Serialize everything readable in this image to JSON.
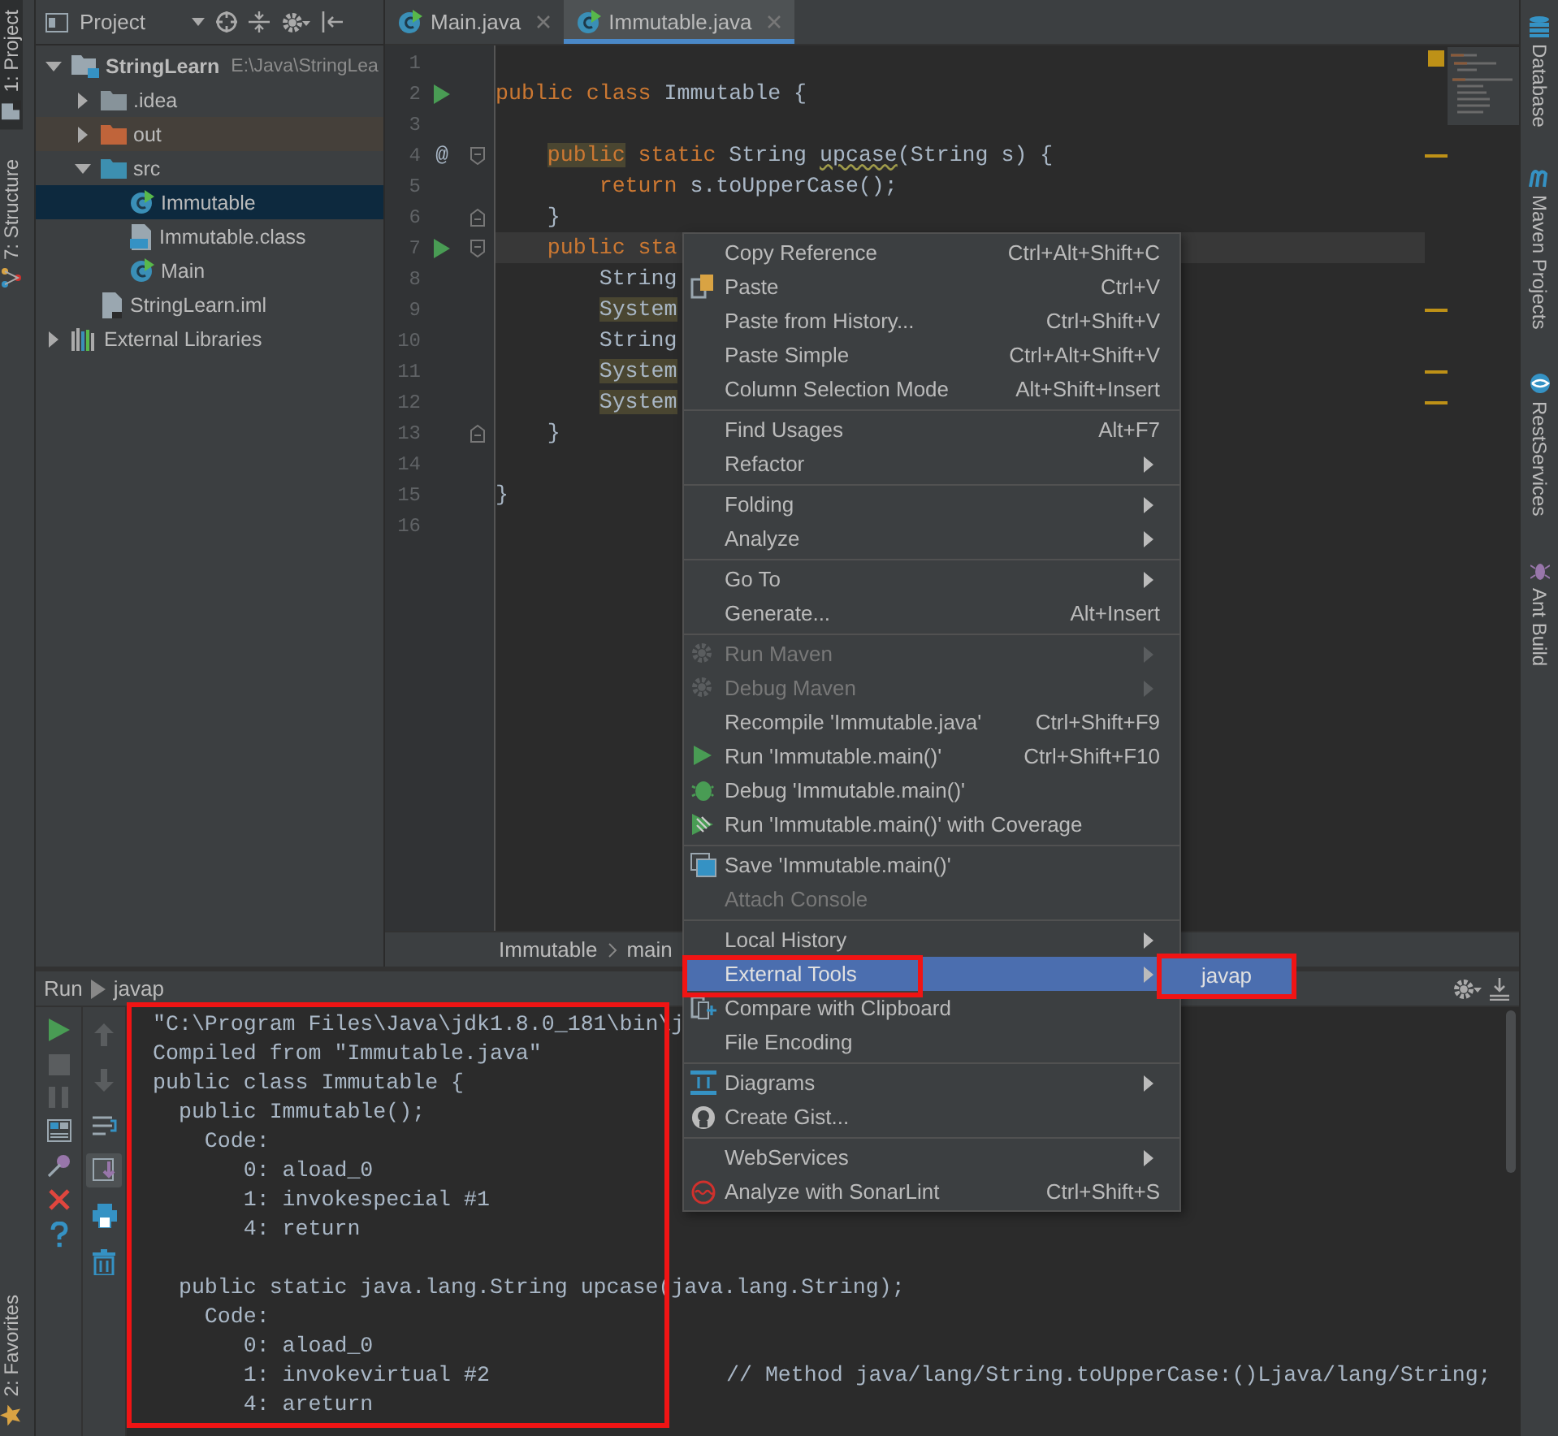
{
  "left_stripe": {
    "top": [
      {
        "label": "1: Project",
        "kind": "project",
        "selected": true
      },
      {
        "label": "7: Structure",
        "kind": "structure",
        "selected": false
      }
    ],
    "bottom": [
      {
        "label": "2: Favorites",
        "kind": "favorites",
        "selected": false
      }
    ]
  },
  "project_panel": {
    "title": "Project",
    "tree": [
      {
        "label": "StringLearn",
        "path": "E:\\Java\\StringLea",
        "kind": "module",
        "expanded": true,
        "selected": false,
        "children": [
          {
            "label": ".idea",
            "kind": "folder",
            "expanded": false,
            "selected": false
          },
          {
            "label": "out",
            "kind": "excluded-folder",
            "expanded": false,
            "selected": false
          },
          {
            "label": "src",
            "kind": "source-folder",
            "expanded": true,
            "selected": false,
            "children": [
              {
                "label": "Immutable",
                "kind": "java-class",
                "selected": true
              },
              {
                "label": "Immutable.class",
                "kind": "class-file",
                "selected": false
              },
              {
                "label": "Main",
                "kind": "java-class",
                "selected": false
              }
            ]
          },
          {
            "label": "StringLearn.iml",
            "kind": "iml-file",
            "selected": false
          }
        ]
      },
      {
        "label": "External Libraries",
        "kind": "libraries",
        "expanded": false,
        "selected": false
      }
    ]
  },
  "editor": {
    "tabs": [
      {
        "label": "Main.java",
        "selected": false
      },
      {
        "label": "Immutable.java",
        "selected": true
      }
    ],
    "lines": [
      {
        "number": "1",
        "kind": "plain",
        "run": false,
        "current": false,
        "warning": false
      },
      {
        "number": "2",
        "kind": "plain",
        "run": true,
        "current": false,
        "warning": false,
        "segments": [
          {
            "text": "public class ",
            "kind": "keyword"
          },
          {
            "text": "Immutable {",
            "kind": "plain"
          }
        ]
      },
      {
        "number": "3",
        "kind": "plain",
        "run": false,
        "current": false,
        "warning": false
      },
      {
        "number": "4",
        "kind": "fold-start",
        "run": false,
        "gutter_text": "@",
        "current": false,
        "warning": true,
        "segments": [
          {
            "text": "    public",
            "kind": "keyword-marked"
          },
          {
            "text": " static ",
            "kind": "keyword"
          },
          {
            "text": "String ",
            "kind": "plain"
          },
          {
            "text": "upcase",
            "kind": "warning"
          },
          {
            "text": "(String s) {",
            "kind": "plain"
          }
        ]
      },
      {
        "number": "5",
        "kind": "plain",
        "run": false,
        "current": false,
        "warning": false,
        "segments": [
          {
            "text": "        return ",
            "kind": "keyword"
          },
          {
            "text": "s.toUpperCase();",
            "kind": "plain"
          }
        ]
      },
      {
        "number": "6",
        "kind": "fold-end",
        "run": false,
        "current": false,
        "warning": false,
        "segments": [
          {
            "text": "    }",
            "kind": "plain"
          }
        ]
      },
      {
        "number": "7",
        "kind": "fold-start",
        "run": true,
        "current": true,
        "warning": false,
        "segments": [
          {
            "text": "    public sta",
            "kind": "keyword"
          }
        ]
      },
      {
        "number": "8",
        "kind": "plain",
        "run": false,
        "current": false,
        "warning": false,
        "segments": [
          {
            "text": "        String",
            "kind": "plain"
          }
        ]
      },
      {
        "number": "9",
        "kind": "plain",
        "run": false,
        "current": false,
        "warning": true,
        "segments": [
          {
            "text": "        System",
            "kind": "plain-marked"
          }
        ]
      },
      {
        "number": "10",
        "kind": "plain",
        "run": false,
        "current": false,
        "warning": false,
        "segments": [
          {
            "text": "        String",
            "kind": "plain"
          }
        ]
      },
      {
        "number": "11",
        "kind": "plain",
        "run": false,
        "current": false,
        "warning": true,
        "segments": [
          {
            "text": "        System",
            "kind": "plain-marked"
          }
        ]
      },
      {
        "number": "12",
        "kind": "plain",
        "run": false,
        "current": false,
        "warning": true,
        "segments": [
          {
            "text": "        System",
            "kind": "plain-marked"
          }
        ]
      },
      {
        "number": "13",
        "kind": "fold-end",
        "run": false,
        "current": false,
        "warning": false,
        "segments": [
          {
            "text": "    }",
            "kind": "plain"
          }
        ]
      },
      {
        "number": "14",
        "kind": "plain",
        "run": false,
        "current": false,
        "warning": false
      },
      {
        "number": "15",
        "kind": "plain",
        "run": false,
        "current": false,
        "warning": false,
        "segments": [
          {
            "text": "}",
            "kind": "plain"
          }
        ]
      },
      {
        "number": "16",
        "kind": "plain",
        "run": false,
        "current": false,
        "warning": false
      }
    ],
    "breadcrumb": [
      "Immutable",
      "main"
    ]
  },
  "context_menu": {
    "groups": [
      [
        {
          "label": "Copy Reference",
          "shortcut": "Ctrl+Alt+Shift+C",
          "kind": "plain",
          "submenu": false,
          "disabled": false,
          "selected": false,
          "outlined": false
        },
        {
          "label": "Paste",
          "shortcut": "Ctrl+V",
          "kind": "paste",
          "submenu": false,
          "disabled": false,
          "selected": false,
          "outlined": false
        },
        {
          "label": "Paste from History...",
          "shortcut": "Ctrl+Shift+V",
          "kind": "plain",
          "submenu": false,
          "disabled": false,
          "selected": false,
          "outlined": false
        },
        {
          "label": "Paste Simple",
          "shortcut": "Ctrl+Alt+Shift+V",
          "kind": "plain",
          "submenu": false,
          "disabled": false,
          "selected": false,
          "outlined": false
        },
        {
          "label": "Column Selection Mode",
          "shortcut": "Alt+Shift+Insert",
          "kind": "plain",
          "submenu": false,
          "disabled": false,
          "selected": false,
          "outlined": false
        }
      ],
      [
        {
          "label": "Find Usages",
          "shortcut": "Alt+F7",
          "kind": "plain",
          "submenu": false,
          "disabled": false,
          "selected": false,
          "outlined": false
        },
        {
          "label": "Refactor",
          "kind": "plain",
          "submenu": true,
          "disabled": false,
          "selected": false,
          "outlined": false
        }
      ],
      [
        {
          "label": "Folding",
          "kind": "plain",
          "submenu": true,
          "disabled": false,
          "selected": false,
          "outlined": false
        },
        {
          "label": "Analyze",
          "kind": "plain",
          "submenu": true,
          "disabled": false,
          "selected": false,
          "outlined": false
        }
      ],
      [
        {
          "label": "Go To",
          "kind": "plain",
          "submenu": true,
          "disabled": false,
          "selected": false,
          "outlined": false
        },
        {
          "label": "Generate...",
          "shortcut": "Alt+Insert",
          "kind": "plain",
          "submenu": false,
          "disabled": false,
          "selected": false,
          "outlined": false
        }
      ],
      [
        {
          "label": "Run Maven",
          "kind": "gear",
          "submenu": true,
          "disabled": true,
          "selected": false,
          "outlined": false
        },
        {
          "label": "Debug Maven",
          "kind": "gear",
          "submenu": true,
          "disabled": true,
          "selected": false,
          "outlined": false
        },
        {
          "label": "Recompile 'Immutable.java'",
          "shortcut": "Ctrl+Shift+F9",
          "kind": "plain",
          "submenu": false,
          "disabled": false,
          "selected": false,
          "outlined": false
        },
        {
          "label": "Run 'Immutable.main()'",
          "shortcut": "Ctrl+Shift+F10",
          "kind": "run",
          "submenu": false,
          "disabled": false,
          "selected": false,
          "outlined": false
        },
        {
          "label": "Debug 'Immutable.main()'",
          "kind": "debug",
          "submenu": false,
          "disabled": false,
          "selected": false,
          "outlined": false
        },
        {
          "label": "Run 'Immutable.main()' with Coverage",
          "kind": "coverage",
          "submenu": false,
          "disabled": false,
          "selected": false,
          "outlined": false
        }
      ],
      [
        {
          "label": "Save 'Immutable.main()'",
          "kind": "save",
          "submenu": false,
          "disabled": false,
          "selected": false,
          "outlined": false
        },
        {
          "label": "Attach Console",
          "kind": "plain",
          "submenu": false,
          "disabled": true,
          "selected": false,
          "outlined": false
        }
      ],
      [
        {
          "label": "Local History",
          "kind": "plain",
          "submenu": true,
          "disabled": false,
          "selected": false,
          "outlined": false
        },
        {
          "label": "External Tools",
          "kind": "plain",
          "submenu": true,
          "disabled": false,
          "selected": true,
          "outlined": true
        },
        {
          "label": "Compare with Clipboard",
          "kind": "compare",
          "submenu": false,
          "disabled": false,
          "selected": false,
          "outlined": false
        },
        {
          "label": "File Encoding",
          "kind": "plain",
          "submenu": false,
          "disabled": false,
          "selected": false,
          "outlined": false
        }
      ],
      [
        {
          "label": "Diagrams",
          "kind": "diagram",
          "submenu": true,
          "disabled": false,
          "selected": false,
          "outlined": false
        },
        {
          "label": "Create Gist...",
          "kind": "gist",
          "submenu": false,
          "disabled": false,
          "selected": false,
          "outlined": false
        }
      ],
      [
        {
          "label": "WebServices",
          "kind": "plain",
          "submenu": true,
          "disabled": false,
          "selected": false,
          "outlined": false
        },
        {
          "label": "Analyze with SonarLint",
          "shortcut": "Ctrl+Shift+S",
          "kind": "sonar",
          "submenu": false,
          "disabled": false,
          "selected": false,
          "outlined": false
        }
      ]
    ],
    "submenu": [
      {
        "label": "javap",
        "selected": true,
        "outlined": true
      }
    ]
  },
  "run_panel": {
    "title": "Run",
    "config": "javap",
    "toolbar": [
      {
        "kind": "run"
      },
      {
        "kind": "stop"
      },
      {
        "kind": "pause"
      },
      {
        "kind": "layout"
      },
      {
        "kind": "pin"
      },
      {
        "kind": "close"
      },
      {
        "kind": "help"
      }
    ],
    "toolbar_2": [
      {
        "kind": "up",
        "on": false
      },
      {
        "kind": "down",
        "on": false
      },
      {
        "kind": "wrap",
        "on": false
      },
      {
        "kind": "scroll-end",
        "on": true
      },
      {
        "kind": "print",
        "on": false
      },
      {
        "kind": "trash",
        "on": false
      }
    ],
    "console": {
      "outlined": true,
      "lines": [
        {
          "kind": "text",
          "text": "\"C:\\Program Files\\Java\\jdk1.8.0_181\\bin\\j"
        },
        {
          "kind": "text",
          "text": "Compiled from \"Immutable.java\""
        },
        {
          "kind": "text",
          "text": "public class Immutable {"
        },
        {
          "kind": "text",
          "text": "  public Immutable();"
        },
        {
          "kind": "text",
          "text": "    Code:"
        },
        {
          "kind": "text",
          "text": "       0: aload_0"
        },
        {
          "kind": "text",
          "text": "       1: invokespecial #1"
        },
        {
          "kind": "text",
          "text": "       4: return"
        },
        {
          "kind": "blank"
        },
        {
          "kind": "text",
          "text": "  public static java.lang.String upcase(java.lang.String);"
        },
        {
          "kind": "text",
          "text": "    Code:"
        },
        {
          "kind": "text",
          "text": "       0: aload_0"
        },
        {
          "kind": "text",
          "text": "       1: invokevirtual #2",
          "comment": "// Method java/lang/String.toUpperCase:()Ljava/lang/String;"
        },
        {
          "kind": "text",
          "text": "       4: areturn"
        }
      ]
    }
  },
  "right_stripe": [
    {
      "label": "Database",
      "kind": "database"
    },
    {
      "label": "Maven Projects",
      "kind": "maven"
    },
    {
      "label": "RestServices",
      "kind": "rest"
    },
    {
      "label": "Ant Build",
      "kind": "ant"
    }
  ]
}
